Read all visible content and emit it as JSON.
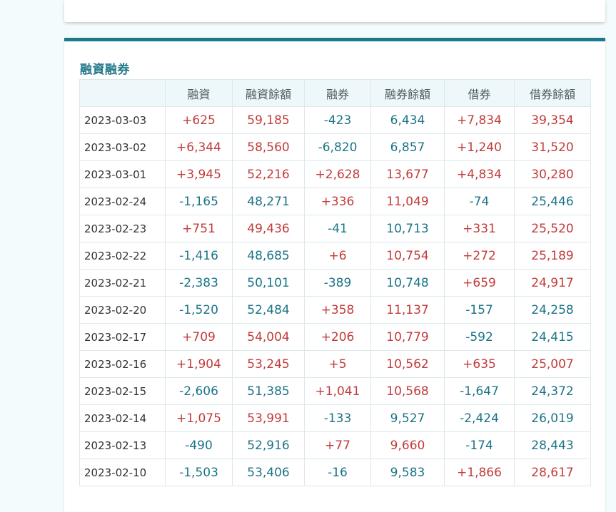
{
  "colors": {
    "up": "#c23b3b",
    "down": "#1c7487",
    "accent": "#1b7b8c"
  },
  "panel": {
    "title": "融資融券"
  },
  "table": {
    "headers": [
      "",
      "融資",
      "融資餘額",
      "融券",
      "融券餘額",
      "借券",
      "借券餘額"
    ],
    "rows": [
      [
        "2023-03-03",
        "+625",
        "59,185",
        "-423",
        "6,434",
        "+7,834",
        "39,354"
      ],
      [
        "2023-03-02",
        "+6,344",
        "58,560",
        "-6,820",
        "6,857",
        "+1,240",
        "31,520"
      ],
      [
        "2023-03-01",
        "+3,945",
        "52,216",
        "+2,628",
        "13,677",
        "+4,834",
        "30,280"
      ],
      [
        "2023-02-24",
        "-1,165",
        "48,271",
        "+336",
        "11,049",
        "-74",
        "25,446"
      ],
      [
        "2023-02-23",
        "+751",
        "49,436",
        "-41",
        "10,713",
        "+331",
        "25,520"
      ],
      [
        "2023-02-22",
        "-1,416",
        "48,685",
        "+6",
        "10,754",
        "+272",
        "25,189"
      ],
      [
        "2023-02-21",
        "-2,383",
        "50,101",
        "-389",
        "10,748",
        "+659",
        "24,917"
      ],
      [
        "2023-02-20",
        "-1,520",
        "52,484",
        "+358",
        "11,137",
        "-157",
        "24,258"
      ],
      [
        "2023-02-17",
        "+709",
        "54,004",
        "+206",
        "10,779",
        "-592",
        "24,415"
      ],
      [
        "2023-02-16",
        "+1,904",
        "53,245",
        "+5",
        "10,562",
        "+635",
        "25,007"
      ],
      [
        "2023-02-15",
        "-2,606",
        "51,385",
        "+1,041",
        "10,568",
        "-1,647",
        "24,372"
      ],
      [
        "2023-02-14",
        "+1,075",
        "53,991",
        "-133",
        "9,527",
        "-2,424",
        "26,019"
      ],
      [
        "2023-02-13",
        "-490",
        "52,916",
        "+77",
        "9,660",
        "-174",
        "28,443"
      ],
      [
        "2023-02-10",
        "-1,503",
        "53,406",
        "-16",
        "9,583",
        "+1,866",
        "28,617"
      ]
    ]
  }
}
